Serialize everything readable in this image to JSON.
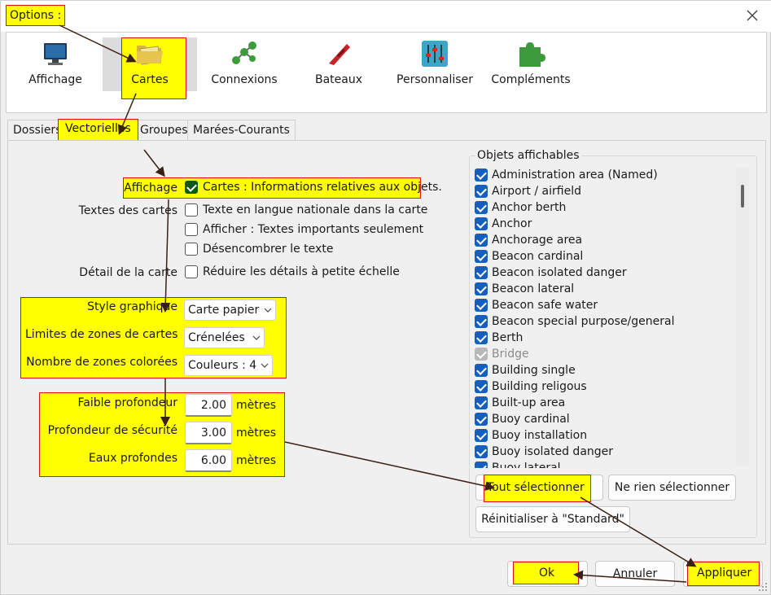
{
  "window": {
    "title": "Options :"
  },
  "toolbar": {
    "items": [
      {
        "label": "Affichage",
        "icon": "monitor-icon"
      },
      {
        "label": "Cartes",
        "icon": "folder-maps-icon"
      },
      {
        "label": "Connexions",
        "icon": "network-nodes-icon"
      },
      {
        "label": "Bateaux",
        "icon": "boat-icon"
      },
      {
        "label": "Personnaliser",
        "icon": "sliders-icon"
      },
      {
        "label": "Compléments",
        "icon": "puzzle-icon"
      }
    ],
    "selected": "Cartes"
  },
  "tabs": [
    "Dossiers",
    "Vectorielles",
    "Groupes",
    "Marées-Courants"
  ],
  "active_tab": "Vectorielles",
  "settings": {
    "affichage_label": "Affichage",
    "affichage_option": "Cartes : Informations relatives aux objets.",
    "textes_label": "Textes des cartes",
    "textes_options": [
      "Texte en langue nationale dans la carte",
      "Afficher : Textes importants seulement",
      "Désencombrer le texte"
    ],
    "detail_label": "Détail de la carte",
    "detail_option": "Réduire les détails à petite échelle",
    "style_label": "Style graphique",
    "style_value": "Carte papier",
    "limites_label": "Limites de zones de cartes",
    "limites_value": "Crénelées",
    "zones_label": "Nombre de zones colorées",
    "zones_value": "Couleurs : 4",
    "faible_label": "Faible profondeur",
    "faible_value": "2.00",
    "securite_label": "Profondeur de sécurité",
    "securite_value": "3.00",
    "eaux_label": "Eaux profondes",
    "eaux_value": "6.00",
    "unit": "mètres"
  },
  "objets": {
    "title": "Objets affichables",
    "items": [
      {
        "label": "Administration area (Named)",
        "checked": true
      },
      {
        "label": "Airport / airfield",
        "checked": true
      },
      {
        "label": "Anchor berth",
        "checked": true
      },
      {
        "label": "Anchor",
        "checked": true
      },
      {
        "label": "Anchorage area",
        "checked": true
      },
      {
        "label": "Beacon cardinal",
        "checked": true
      },
      {
        "label": "Beacon isolated danger",
        "checked": true
      },
      {
        "label": "Beacon lateral",
        "checked": true
      },
      {
        "label": "Beacon safe water",
        "checked": true
      },
      {
        "label": "Beacon special purpose/general",
        "checked": true
      },
      {
        "label": "Berth",
        "checked": true
      },
      {
        "label": "Bridge",
        "checked": true,
        "disabled": true
      },
      {
        "label": "Building single",
        "checked": true
      },
      {
        "label": "Building religous",
        "checked": true
      },
      {
        "label": "Built-up area",
        "checked": true
      },
      {
        "label": "Buoy cardinal",
        "checked": true
      },
      {
        "label": "Buoy installation",
        "checked": true
      },
      {
        "label": "Buoy isolated danger",
        "checked": true
      },
      {
        "label": "Buoy lateral",
        "checked": true
      }
    ],
    "select_all": "Tout sélectionner",
    "select_none": "Ne rien sélectionner",
    "reset": "Réinitialiser à \"Standard\""
  },
  "footer": {
    "ok": "Ok",
    "cancel": "Annuler",
    "apply": "Appliquer"
  },
  "colors": {
    "highlight": "#ffff00",
    "highlight_border": "#dd1111",
    "checkbox_accent": "#1560bd",
    "arrow": "#3a1f14"
  }
}
